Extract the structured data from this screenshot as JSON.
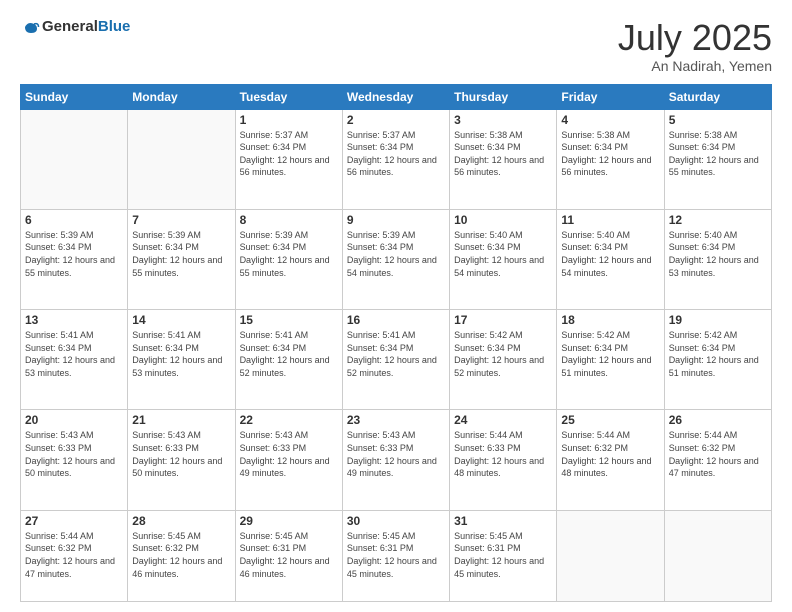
{
  "logo": {
    "text_general": "General",
    "text_blue": "Blue"
  },
  "header": {
    "month": "July 2025",
    "location": "An Nadirah, Yemen"
  },
  "weekdays": [
    "Sunday",
    "Monday",
    "Tuesday",
    "Wednesday",
    "Thursday",
    "Friday",
    "Saturday"
  ],
  "weeks": [
    [
      {
        "day": "",
        "sunrise": "",
        "sunset": "",
        "daylight": ""
      },
      {
        "day": "",
        "sunrise": "",
        "sunset": "",
        "daylight": ""
      },
      {
        "day": "1",
        "sunrise": "Sunrise: 5:37 AM",
        "sunset": "Sunset: 6:34 PM",
        "daylight": "Daylight: 12 hours and 56 minutes."
      },
      {
        "day": "2",
        "sunrise": "Sunrise: 5:37 AM",
        "sunset": "Sunset: 6:34 PM",
        "daylight": "Daylight: 12 hours and 56 minutes."
      },
      {
        "day": "3",
        "sunrise": "Sunrise: 5:38 AM",
        "sunset": "Sunset: 6:34 PM",
        "daylight": "Daylight: 12 hours and 56 minutes."
      },
      {
        "day": "4",
        "sunrise": "Sunrise: 5:38 AM",
        "sunset": "Sunset: 6:34 PM",
        "daylight": "Daylight: 12 hours and 56 minutes."
      },
      {
        "day": "5",
        "sunrise": "Sunrise: 5:38 AM",
        "sunset": "Sunset: 6:34 PM",
        "daylight": "Daylight: 12 hours and 55 minutes."
      }
    ],
    [
      {
        "day": "6",
        "sunrise": "Sunrise: 5:39 AM",
        "sunset": "Sunset: 6:34 PM",
        "daylight": "Daylight: 12 hours and 55 minutes."
      },
      {
        "day": "7",
        "sunrise": "Sunrise: 5:39 AM",
        "sunset": "Sunset: 6:34 PM",
        "daylight": "Daylight: 12 hours and 55 minutes."
      },
      {
        "day": "8",
        "sunrise": "Sunrise: 5:39 AM",
        "sunset": "Sunset: 6:34 PM",
        "daylight": "Daylight: 12 hours and 55 minutes."
      },
      {
        "day": "9",
        "sunrise": "Sunrise: 5:39 AM",
        "sunset": "Sunset: 6:34 PM",
        "daylight": "Daylight: 12 hours and 54 minutes."
      },
      {
        "day": "10",
        "sunrise": "Sunrise: 5:40 AM",
        "sunset": "Sunset: 6:34 PM",
        "daylight": "Daylight: 12 hours and 54 minutes."
      },
      {
        "day": "11",
        "sunrise": "Sunrise: 5:40 AM",
        "sunset": "Sunset: 6:34 PM",
        "daylight": "Daylight: 12 hours and 54 minutes."
      },
      {
        "day": "12",
        "sunrise": "Sunrise: 5:40 AM",
        "sunset": "Sunset: 6:34 PM",
        "daylight": "Daylight: 12 hours and 53 minutes."
      }
    ],
    [
      {
        "day": "13",
        "sunrise": "Sunrise: 5:41 AM",
        "sunset": "Sunset: 6:34 PM",
        "daylight": "Daylight: 12 hours and 53 minutes."
      },
      {
        "day": "14",
        "sunrise": "Sunrise: 5:41 AM",
        "sunset": "Sunset: 6:34 PM",
        "daylight": "Daylight: 12 hours and 53 minutes."
      },
      {
        "day": "15",
        "sunrise": "Sunrise: 5:41 AM",
        "sunset": "Sunset: 6:34 PM",
        "daylight": "Daylight: 12 hours and 52 minutes."
      },
      {
        "day": "16",
        "sunrise": "Sunrise: 5:41 AM",
        "sunset": "Sunset: 6:34 PM",
        "daylight": "Daylight: 12 hours and 52 minutes."
      },
      {
        "day": "17",
        "sunrise": "Sunrise: 5:42 AM",
        "sunset": "Sunset: 6:34 PM",
        "daylight": "Daylight: 12 hours and 52 minutes."
      },
      {
        "day": "18",
        "sunrise": "Sunrise: 5:42 AM",
        "sunset": "Sunset: 6:34 PM",
        "daylight": "Daylight: 12 hours and 51 minutes."
      },
      {
        "day": "19",
        "sunrise": "Sunrise: 5:42 AM",
        "sunset": "Sunset: 6:34 PM",
        "daylight": "Daylight: 12 hours and 51 minutes."
      }
    ],
    [
      {
        "day": "20",
        "sunrise": "Sunrise: 5:43 AM",
        "sunset": "Sunset: 6:33 PM",
        "daylight": "Daylight: 12 hours and 50 minutes."
      },
      {
        "day": "21",
        "sunrise": "Sunrise: 5:43 AM",
        "sunset": "Sunset: 6:33 PM",
        "daylight": "Daylight: 12 hours and 50 minutes."
      },
      {
        "day": "22",
        "sunrise": "Sunrise: 5:43 AM",
        "sunset": "Sunset: 6:33 PM",
        "daylight": "Daylight: 12 hours and 49 minutes."
      },
      {
        "day": "23",
        "sunrise": "Sunrise: 5:43 AM",
        "sunset": "Sunset: 6:33 PM",
        "daylight": "Daylight: 12 hours and 49 minutes."
      },
      {
        "day": "24",
        "sunrise": "Sunrise: 5:44 AM",
        "sunset": "Sunset: 6:33 PM",
        "daylight": "Daylight: 12 hours and 48 minutes."
      },
      {
        "day": "25",
        "sunrise": "Sunrise: 5:44 AM",
        "sunset": "Sunset: 6:32 PM",
        "daylight": "Daylight: 12 hours and 48 minutes."
      },
      {
        "day": "26",
        "sunrise": "Sunrise: 5:44 AM",
        "sunset": "Sunset: 6:32 PM",
        "daylight": "Daylight: 12 hours and 47 minutes."
      }
    ],
    [
      {
        "day": "27",
        "sunrise": "Sunrise: 5:44 AM",
        "sunset": "Sunset: 6:32 PM",
        "daylight": "Daylight: 12 hours and 47 minutes."
      },
      {
        "day": "28",
        "sunrise": "Sunrise: 5:45 AM",
        "sunset": "Sunset: 6:32 PM",
        "daylight": "Daylight: 12 hours and 46 minutes."
      },
      {
        "day": "29",
        "sunrise": "Sunrise: 5:45 AM",
        "sunset": "Sunset: 6:31 PM",
        "daylight": "Daylight: 12 hours and 46 minutes."
      },
      {
        "day": "30",
        "sunrise": "Sunrise: 5:45 AM",
        "sunset": "Sunset: 6:31 PM",
        "daylight": "Daylight: 12 hours and 45 minutes."
      },
      {
        "day": "31",
        "sunrise": "Sunrise: 5:45 AM",
        "sunset": "Sunset: 6:31 PM",
        "daylight": "Daylight: 12 hours and 45 minutes."
      },
      {
        "day": "",
        "sunrise": "",
        "sunset": "",
        "daylight": ""
      },
      {
        "day": "",
        "sunrise": "",
        "sunset": "",
        "daylight": ""
      }
    ]
  ]
}
